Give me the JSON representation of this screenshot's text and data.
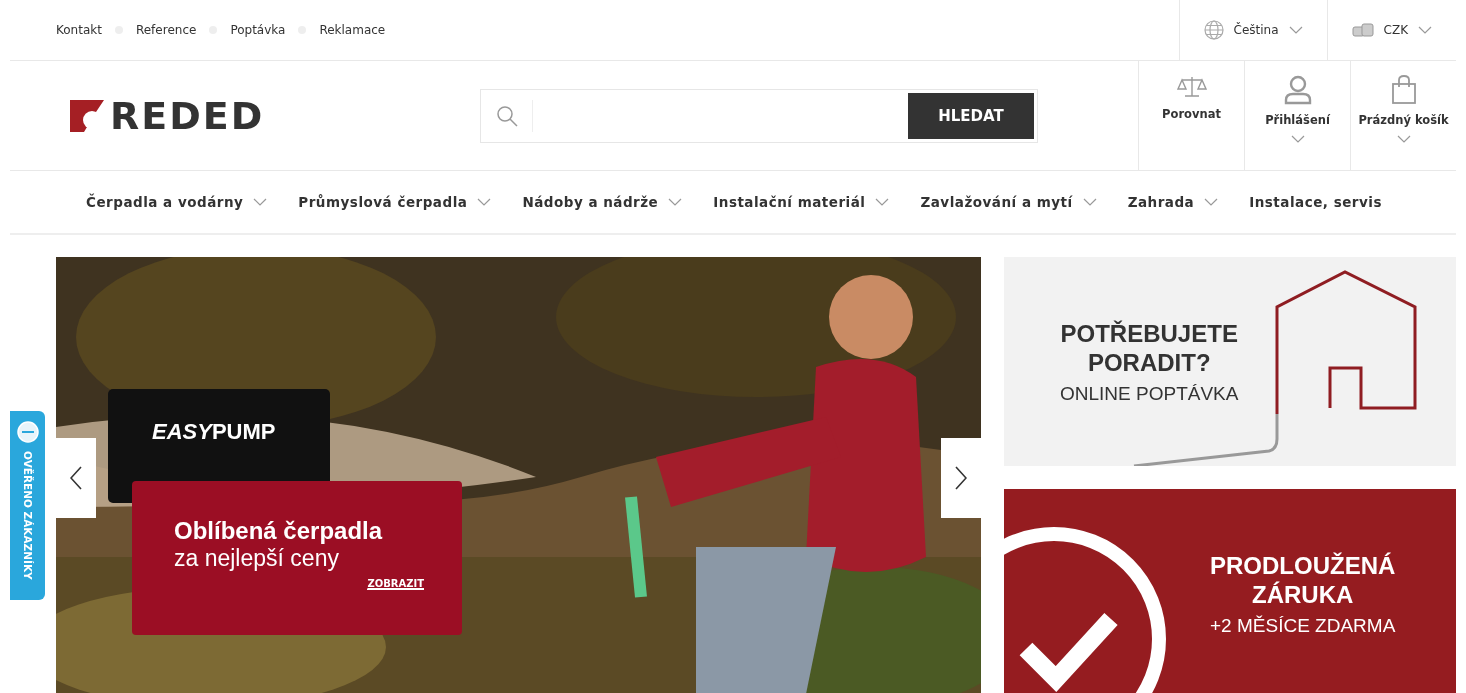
{
  "top_links": [
    "Kontakt",
    "Reference",
    "Poptávka",
    "Reklamace"
  ],
  "language": {
    "label": "Čeština"
  },
  "currency": {
    "label": "CZK"
  },
  "logo": "REDED",
  "search": {
    "button": "HLEDAT"
  },
  "header_actions": [
    {
      "kind": "compare",
      "label": "Porovnat",
      "has_dropdown": false
    },
    {
      "kind": "user",
      "label": "Přihlášení",
      "has_dropdown": true
    },
    {
      "kind": "cart",
      "label": "Prázdný košík",
      "has_dropdown": true
    }
  ],
  "nav": [
    {
      "label": "Čerpadla a vodárny",
      "has_dropdown": true
    },
    {
      "label": "Průmyslová čerpadla",
      "has_dropdown": true
    },
    {
      "label": "Nádoby a nádrže",
      "has_dropdown": true
    },
    {
      "label": "Instalační materiál",
      "has_dropdown": true
    },
    {
      "label": "Zavlažování a mytí",
      "has_dropdown": true
    },
    {
      "label": "Zahrada",
      "has_dropdown": true
    },
    {
      "label": "Instalace, servis",
      "has_dropdown": false
    }
  ],
  "hero": {
    "kind": "picture",
    "brand": {
      "italic_part": "EASY",
      "rest": "PUMP"
    },
    "title": "Oblíbená čerpadla",
    "subtitle": "za nejlepší ceny",
    "link": "ZOBRAZIT"
  },
  "side_badge": "OVĚŘENO ZÁKAZNÍKY",
  "promos": [
    {
      "kind": "house",
      "title_lines": [
        "POTŘEBUJETE",
        "PORADIT?"
      ],
      "subtitle": "ONLINE POPTÁVKA"
    },
    {
      "kind": "check",
      "title_lines": [
        "PRODLOUŽENÁ",
        "ZÁRUKA"
      ],
      "subtitle": "+2 MĚSÍCE ZDARMA"
    }
  ]
}
